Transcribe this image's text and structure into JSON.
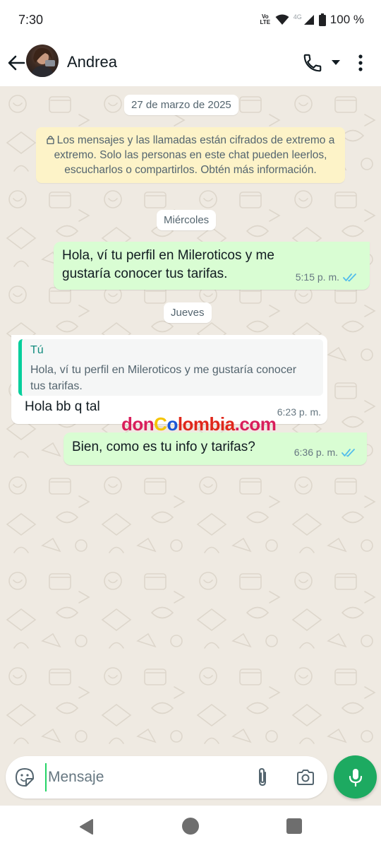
{
  "status_bar": {
    "time": "7:30",
    "volte": "Vo\nLTE",
    "network": "4G",
    "battery": "100 %"
  },
  "header": {
    "contact_name": "Andrea"
  },
  "chat": {
    "date_label": "27 de marzo de 2025",
    "encryption_notice": "Los mensajes y las llamadas están cifrados de extremo a extremo. Solo las personas en este chat pueden leerlos, escucharlos o compartirlos. Obtén más información.",
    "day_wednesday": "Miércoles",
    "day_thursday": "Jueves",
    "messages": [
      {
        "direction": "outgoing",
        "text": "Hola, ví tu perfil en Mileroticos y me gustaría conocer tus tarifas.",
        "time": "5:15 p. m.",
        "status": "read"
      },
      {
        "direction": "incoming",
        "quote_author": "Tú",
        "quote_text": "Hola, ví tu perfil en Mileroticos y me gustaría conocer tus tarifas.",
        "text": "Hola bb q tal",
        "time": "6:23 p. m."
      },
      {
        "direction": "outgoing",
        "text": "Bien, como es tu info y tarifas?",
        "time": "6:36 p. m.",
        "status": "read"
      }
    ],
    "watermark": {
      "part1": "don",
      "part2": "C",
      "part3": "o",
      "part4": "lombia",
      "part5": ".com"
    }
  },
  "input": {
    "placeholder": "Mensaje"
  },
  "colors": {
    "outgoing_bubble": "#d9fdd3",
    "incoming_bubble": "#ffffff",
    "accent_green": "#1daa61",
    "read_ticks": "#53bdeb",
    "notice_bg": "#fdf3c8"
  }
}
